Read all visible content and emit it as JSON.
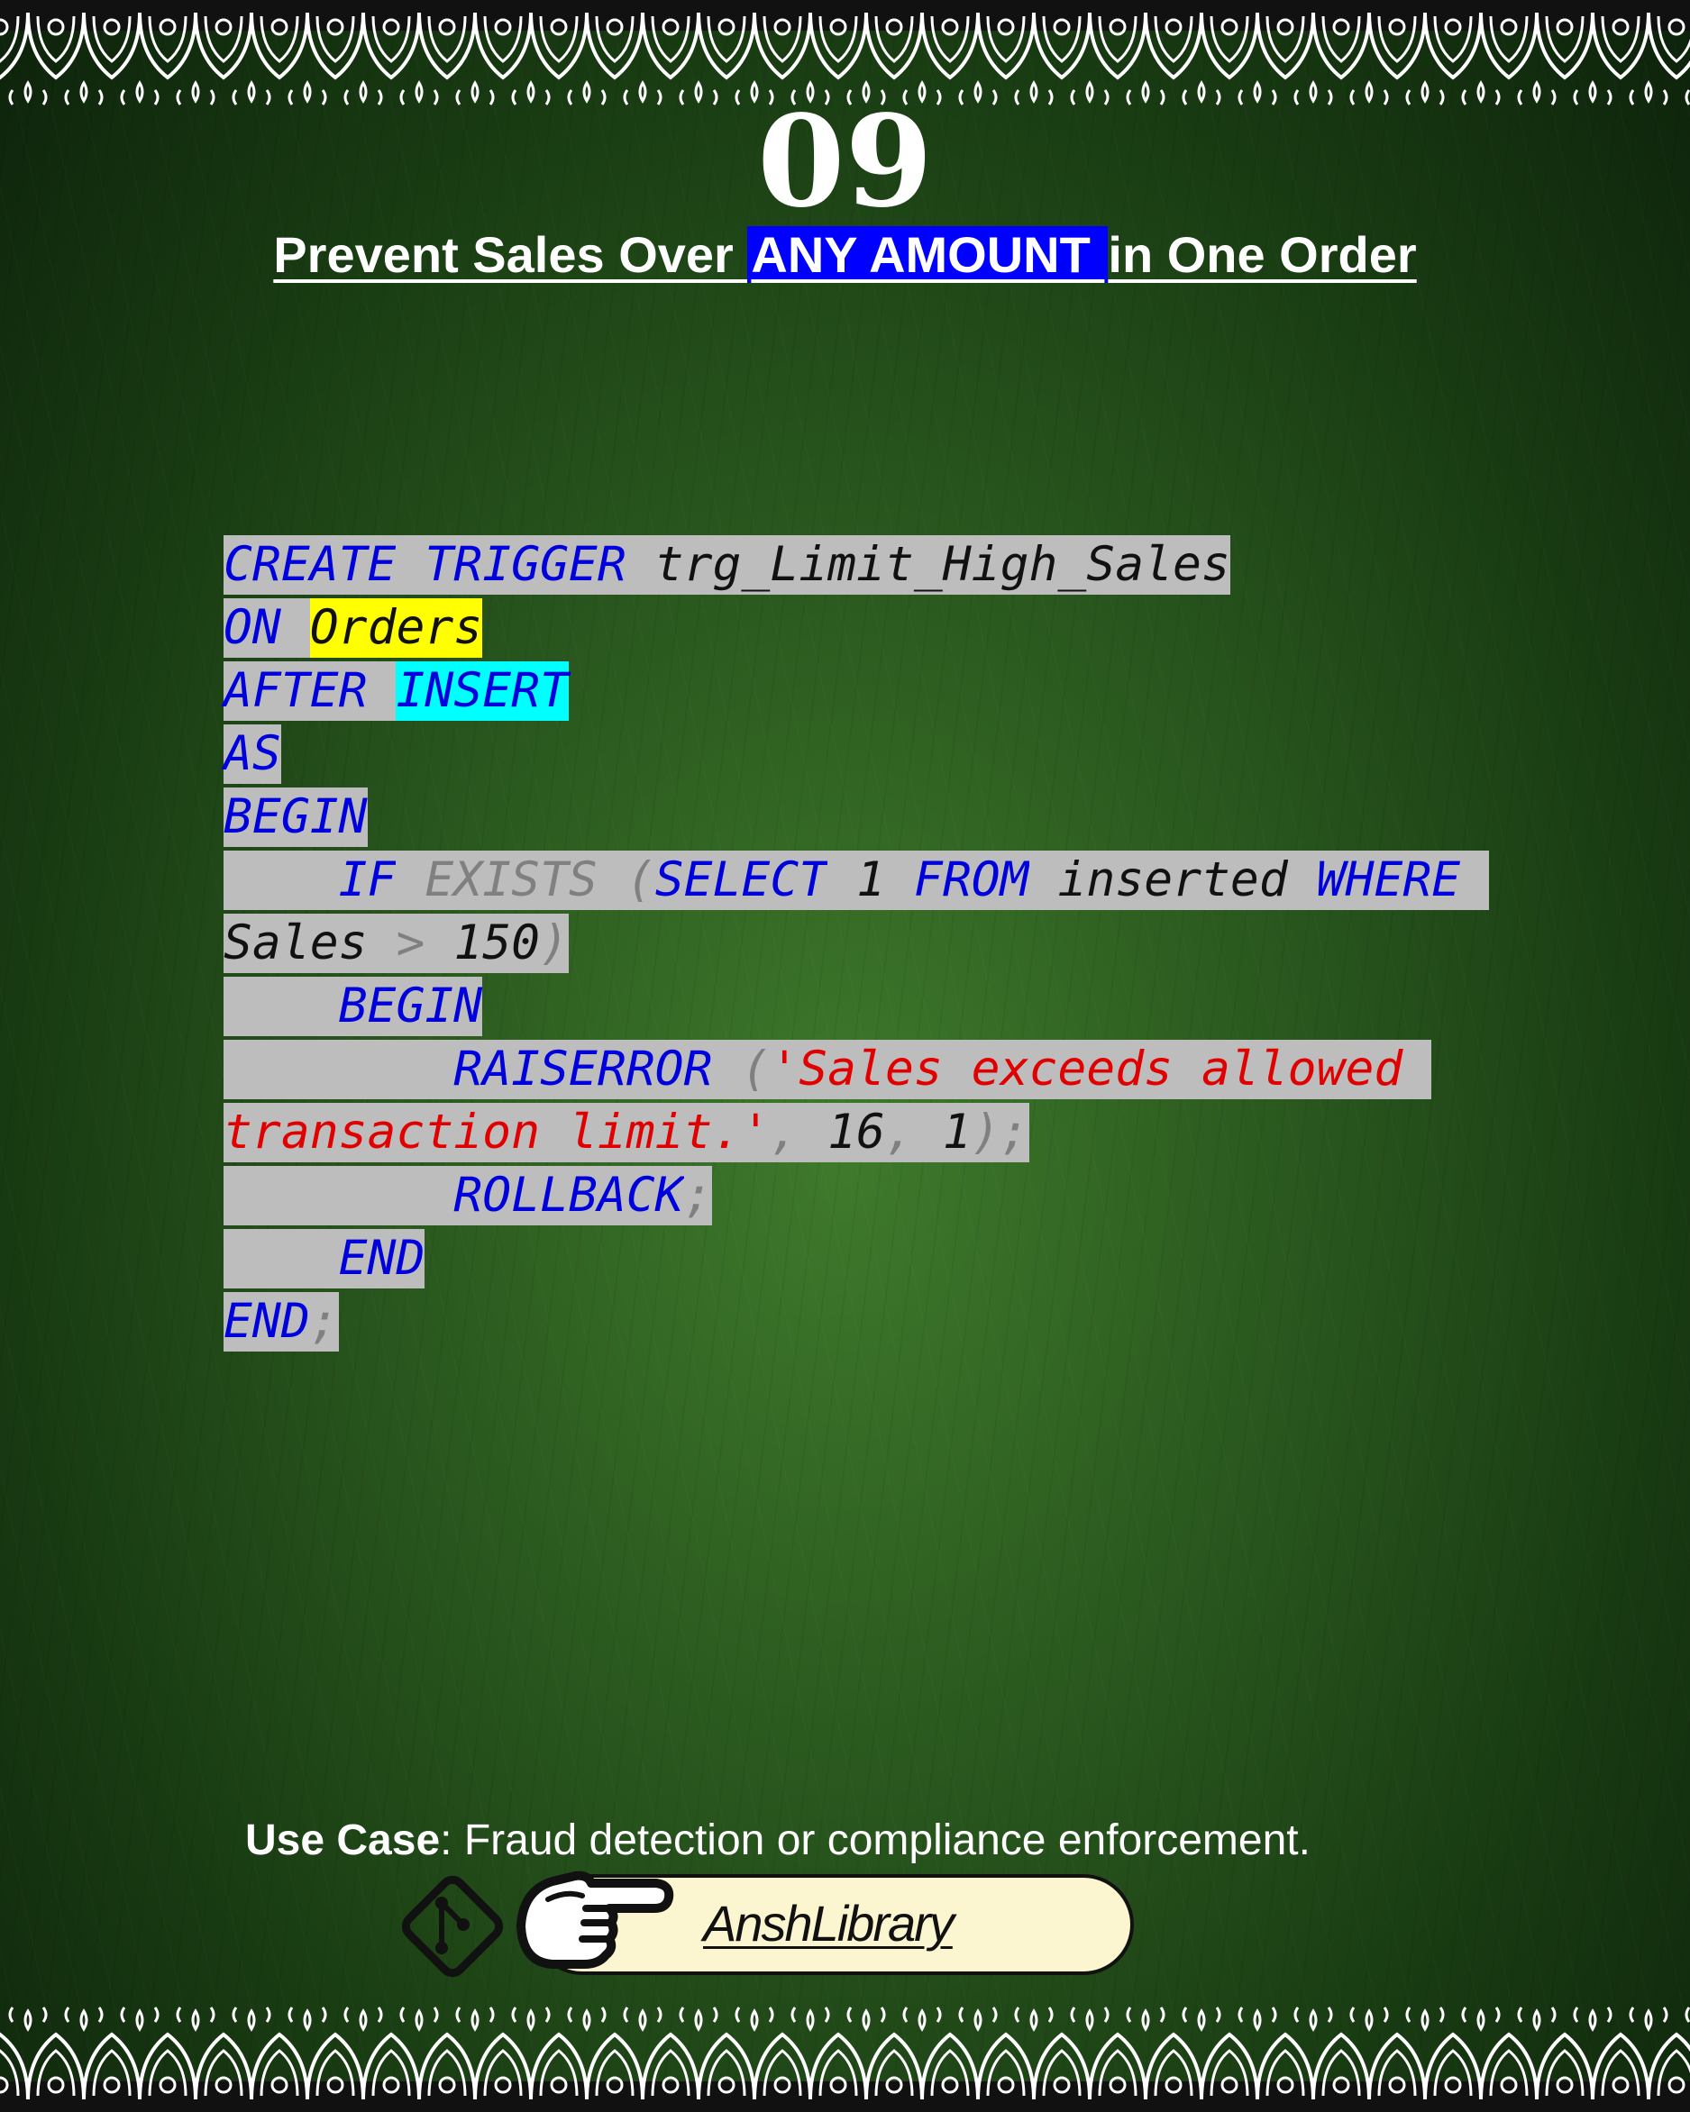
{
  "number": "09",
  "title": {
    "before": "Prevent Sales Over ",
    "highlight": "ANY AMOUNT ",
    "after": "in One Order"
  },
  "code_lines": [
    [
      {
        "t": "CREATE",
        "c": "kw"
      },
      {
        "t": " ",
        "c": ""
      },
      {
        "t": "TRIGGER",
        "c": "kw"
      },
      {
        "t": " ",
        "c": ""
      },
      {
        "t": "trg_Limit_High_Sales",
        "c": "id"
      }
    ],
    [
      {
        "t": "ON",
        "c": "kw"
      },
      {
        "t": " ",
        "c": ""
      },
      {
        "t": "Orders",
        "c": "id yl"
      }
    ],
    [
      {
        "t": "AFTER",
        "c": "kw"
      },
      {
        "t": " ",
        "c": ""
      },
      {
        "t": "INSERT",
        "c": "kw cy"
      }
    ],
    [
      {
        "t": "AS",
        "c": "kw"
      }
    ],
    [
      {
        "t": "BEGIN",
        "c": "kw"
      }
    ],
    [
      {
        "t": "    ",
        "c": ""
      },
      {
        "t": "IF",
        "c": "kw"
      },
      {
        "t": " ",
        "c": ""
      },
      {
        "t": "EXISTS",
        "c": "gr"
      },
      {
        "t": " ",
        "c": ""
      },
      {
        "t": "(",
        "c": "gr"
      },
      {
        "t": "SELECT",
        "c": "kw"
      },
      {
        "t": " ",
        "c": ""
      },
      {
        "t": "1",
        "c": "id"
      },
      {
        "t": " ",
        "c": ""
      },
      {
        "t": "FROM",
        "c": "kw"
      },
      {
        "t": " ",
        "c": ""
      },
      {
        "t": "inserted",
        "c": "id"
      },
      {
        "t": " ",
        "c": ""
      },
      {
        "t": "WHERE",
        "c": "kw"
      },
      {
        "t": " ",
        "c": ""
      }
    ],
    [
      {
        "t": "Sales",
        "c": "id"
      },
      {
        "t": " ",
        "c": ""
      },
      {
        "t": ">",
        "c": "gr"
      },
      {
        "t": " ",
        "c": ""
      },
      {
        "t": "150",
        "c": "id"
      },
      {
        "t": ")",
        "c": "gr"
      }
    ],
    [
      {
        "t": "    ",
        "c": ""
      },
      {
        "t": "BEGIN",
        "c": "kw"
      }
    ],
    [
      {
        "t": "        ",
        "c": ""
      },
      {
        "t": "RAISERROR",
        "c": "kw"
      },
      {
        "t": " ",
        "c": ""
      },
      {
        "t": "(",
        "c": "gr"
      },
      {
        "t": "'Sales exceeds allowed ",
        "c": "str"
      }
    ],
    [
      {
        "t": "transaction limit.'",
        "c": "str"
      },
      {
        "t": ",",
        "c": "gr"
      },
      {
        "t": " ",
        "c": ""
      },
      {
        "t": "16",
        "c": "id"
      },
      {
        "t": ",",
        "c": "gr"
      },
      {
        "t": " ",
        "c": ""
      },
      {
        "t": "1",
        "c": "id"
      },
      {
        "t": ");",
        "c": "gr"
      }
    ],
    [
      {
        "t": "        ",
        "c": ""
      },
      {
        "t": "ROLLBACK",
        "c": "kw"
      },
      {
        "t": ";",
        "c": "gr"
      }
    ],
    [
      {
        "t": "    ",
        "c": ""
      },
      {
        "t": "END",
        "c": "kw"
      }
    ],
    [
      {
        "t": "END",
        "c": "kw"
      },
      {
        "t": ";",
        "c": "gr"
      }
    ]
  ],
  "use_case": {
    "label": "Use Case",
    "text": ": Fraud detection or compliance enforcement."
  },
  "brand": "AnshLibrary",
  "icons": [
    "git-icon",
    "pointing-hand-icon"
  ],
  "colors": {
    "keyword": "#0000dd",
    "string": "#e00000",
    "title_highlight": "#0000ff",
    "table_highlight": "#ffff00",
    "event_highlight": "#00ffff",
    "code_bg": "#bdbdbd"
  }
}
